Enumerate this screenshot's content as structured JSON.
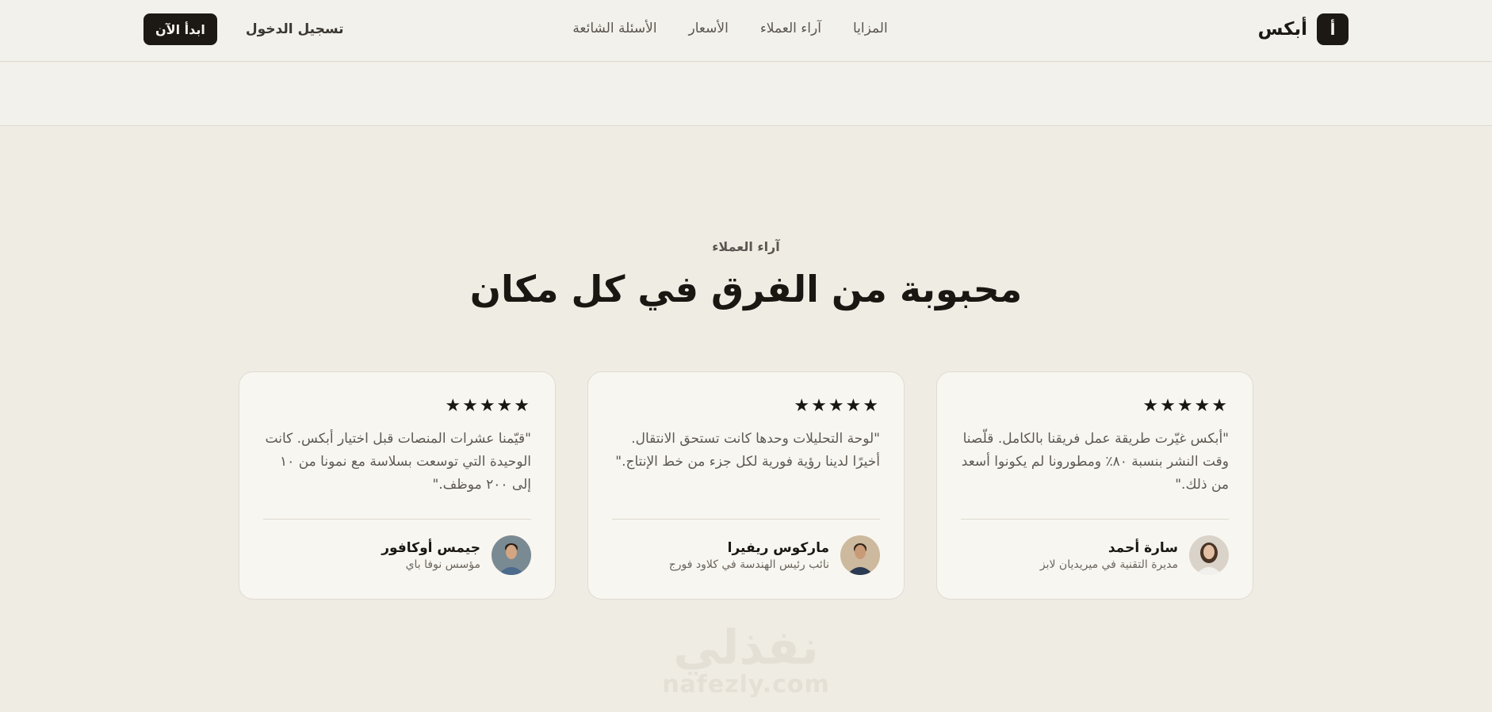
{
  "brand": {
    "mark": "أ",
    "name": "أبكس"
  },
  "nav": {
    "features": "المزايا",
    "testimonials": "آراء العملاء",
    "pricing": "الأسعار",
    "faq": "الأسئلة الشائعة"
  },
  "actions": {
    "login": "تسجيل الدخول",
    "start": "ابدأ الآن"
  },
  "section": {
    "eyebrow": "آراء العملاء",
    "title": "محبوبة من الفرق في كل مكان"
  },
  "testimonials": [
    {
      "stars": "★★★★★",
      "quote": "\"أبكس غيّرت طريقة عمل فريقنا بالكامل. قلّصنا وقت النشر بنسبة ٨٠٪ ومطورونا لم يكونوا أسعد من ذلك.\"",
      "name": "سارة أحمد",
      "role": "مديرة التقنية في ميريديان لابز",
      "avatar_colors": {
        "bg": "#d9d3c9",
        "hair": "#4a3426",
        "skin": "#e3bfa3",
        "shirt": "#f2f0ec"
      }
    },
    {
      "stars": "★★★★★",
      "quote": "\"لوحة التحليلات وحدها كانت تستحق الانتقال. أخيرًا لدينا رؤية فورية لكل جزء من خط الإنتاج.\"",
      "name": "ماركوس ريفيرا",
      "role": "نائب رئيس الهندسة في كلاود فورج",
      "avatar_colors": {
        "bg": "#cdb99d",
        "hair": "#2e241c",
        "skin": "#c99a78",
        "shirt": "#2b3a52"
      }
    },
    {
      "stars": "★★★★★",
      "quote": "\"قيّمنا عشرات المنصات قبل اختيار أبكس. كانت الوحيدة التي توسعت بسلاسة مع نمونا من ١٠ إلى ٢٠٠ موظف.\"",
      "name": "جيمس أوكافور",
      "role": "مؤسس نوفا باي",
      "avatar_colors": {
        "bg": "#7a8a93",
        "hair": "#2a1f18",
        "skin": "#d2a683",
        "shirt": "#4b6a8c"
      }
    }
  ],
  "watermark": {
    "arabic": "نفذلي",
    "latin": "nafezly.com"
  }
}
